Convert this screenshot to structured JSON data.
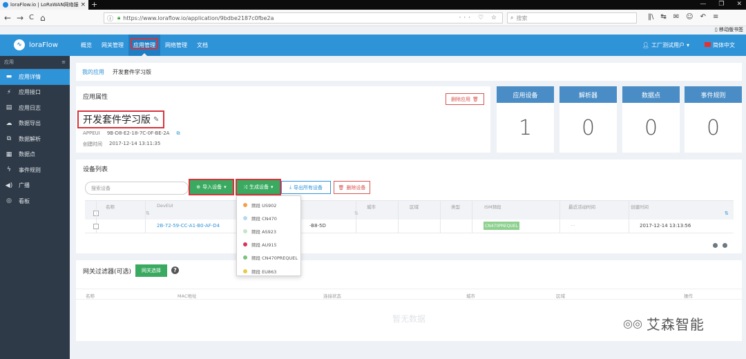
{
  "browser": {
    "tab_title": "loraFlow.io | LoRaWAN网络服",
    "new_tab": "+",
    "window_controls": [
      "—",
      "❐",
      "✕"
    ],
    "url": "https://www.loraflow.io/application/9bdbe2187c0fbe2a",
    "search_placeholder": "搜索",
    "mobile_bookmarks": "移动版书签",
    "nav_back": "←",
    "nav_forward": "→",
    "nav_reload": "C",
    "nav_home": "⌂",
    "url_icons": "··· ♡ ☆",
    "tool_icons": [
      "‖\\",
      "↹",
      "✉",
      "☺",
      "↶",
      "≡"
    ]
  },
  "header": {
    "logo_text": "loraFlow",
    "nav": [
      "概览",
      "网关管理",
      "应用管理",
      "网络管理",
      "文档"
    ],
    "active_nav": "应用管理",
    "user": "工厂测试用户",
    "language": "简体中文"
  },
  "sidebar": {
    "section": "应用",
    "collapse_icon": "≡",
    "items": [
      {
        "label": "应用详情",
        "icon": "▬"
      },
      {
        "label": "应用接口",
        "icon": "⚡"
      },
      {
        "label": "应用日志",
        "icon": "▤"
      },
      {
        "label": "数据导出",
        "icon": "☁"
      },
      {
        "label": "数据解析",
        "icon": "⧉"
      },
      {
        "label": "数据点",
        "icon": "▦"
      },
      {
        "label": "事件规则",
        "icon": "ϟ"
      },
      {
        "label": "广播",
        "icon": "◀)"
      },
      {
        "label": "看板",
        "icon": "◎"
      }
    ]
  },
  "breadcrumb": {
    "parent": "我的应用",
    "current": "开发套件学习版"
  },
  "app_props": {
    "title": "应用属性",
    "delete_label": "删除应用",
    "name": "开发套件学习版",
    "appeui_label": "APPEUI",
    "appeui_value": "9B-D8-E2-18-7C-0F-BE-2A",
    "created_label": "创建时间",
    "created_value": "2017-12-14 13:11:35"
  },
  "stats": [
    {
      "label": "应用设备",
      "value": "1"
    },
    {
      "label": "解析器",
      "value": "0"
    },
    {
      "label": "数据点",
      "value": "0"
    },
    {
      "label": "事件规则",
      "value": "0"
    }
  ],
  "devices": {
    "title": "设备列表",
    "search_placeholder": "搜索设备",
    "import_label": "导入设备",
    "generate_label": "生成设备",
    "export_label": "导出所有设备",
    "delete_label": "删除设备",
    "columns": [
      "名称",
      "DevEUI",
      "城市",
      "区域",
      "类型",
      "ISM频段",
      "最近活动时间",
      "创建时间"
    ],
    "sort_icon": "⇅",
    "rows": [
      {
        "name": "",
        "deveui": "2B-72-59-CC-A1-B0-AF-D4",
        "appkey_tail": "-B8-5D",
        "city": "",
        "area": "",
        "type": "",
        "ism": "CN470PREQUEL",
        "last_active": "···",
        "created": "2017-12-14 13:13:56"
      }
    ]
  },
  "band_menu": {
    "items": [
      {
        "label": "频段 US902",
        "color": "#f2a14a"
      },
      {
        "label": "频段 CN470",
        "color": "#b9d7ef"
      },
      {
        "label": "频段 AS923",
        "color": "#c6e5c6"
      },
      {
        "label": "频段 AU915",
        "color": "#d9325f"
      },
      {
        "label": "频段 CN470PREQUEL",
        "color": "#7cc27c"
      },
      {
        "label": "频段 EU863",
        "color": "#e8c94a"
      }
    ]
  },
  "gateway_filter": {
    "title": "网关过滤器(可选)",
    "select_label": "网关选择",
    "help": "?",
    "columns": [
      "名称",
      "MAC地址",
      "连接状态",
      "城市",
      "区域",
      "操作"
    ],
    "empty": "暂无数据"
  },
  "watermark": "艾森智能",
  "colors": {
    "header_bg": "#2f93d8",
    "sidebar_bg": "#2e3a47",
    "stat_header": "#4a8dc6",
    "green_btn": "#3aaa61",
    "highlight_red": "#d8323a"
  }
}
